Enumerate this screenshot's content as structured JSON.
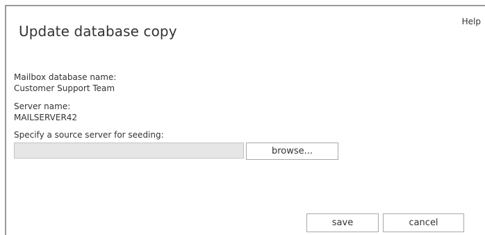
{
  "dialog": {
    "title": "Update database copy",
    "help_label": "Help"
  },
  "fields": {
    "mailbox_db_label": "Mailbox database name:",
    "mailbox_db_value": "Customer Support Team",
    "server_label": "Server name:",
    "server_value": "MAILSERVER42",
    "source_label": "Specify a source server for seeding:",
    "source_value": ""
  },
  "buttons": {
    "browse": "browse...",
    "save": "save",
    "cancel": "cancel"
  },
  "colors": {
    "border": "#9a9a9a",
    "input_bg": "#e6e6e6",
    "text": "#333333"
  }
}
